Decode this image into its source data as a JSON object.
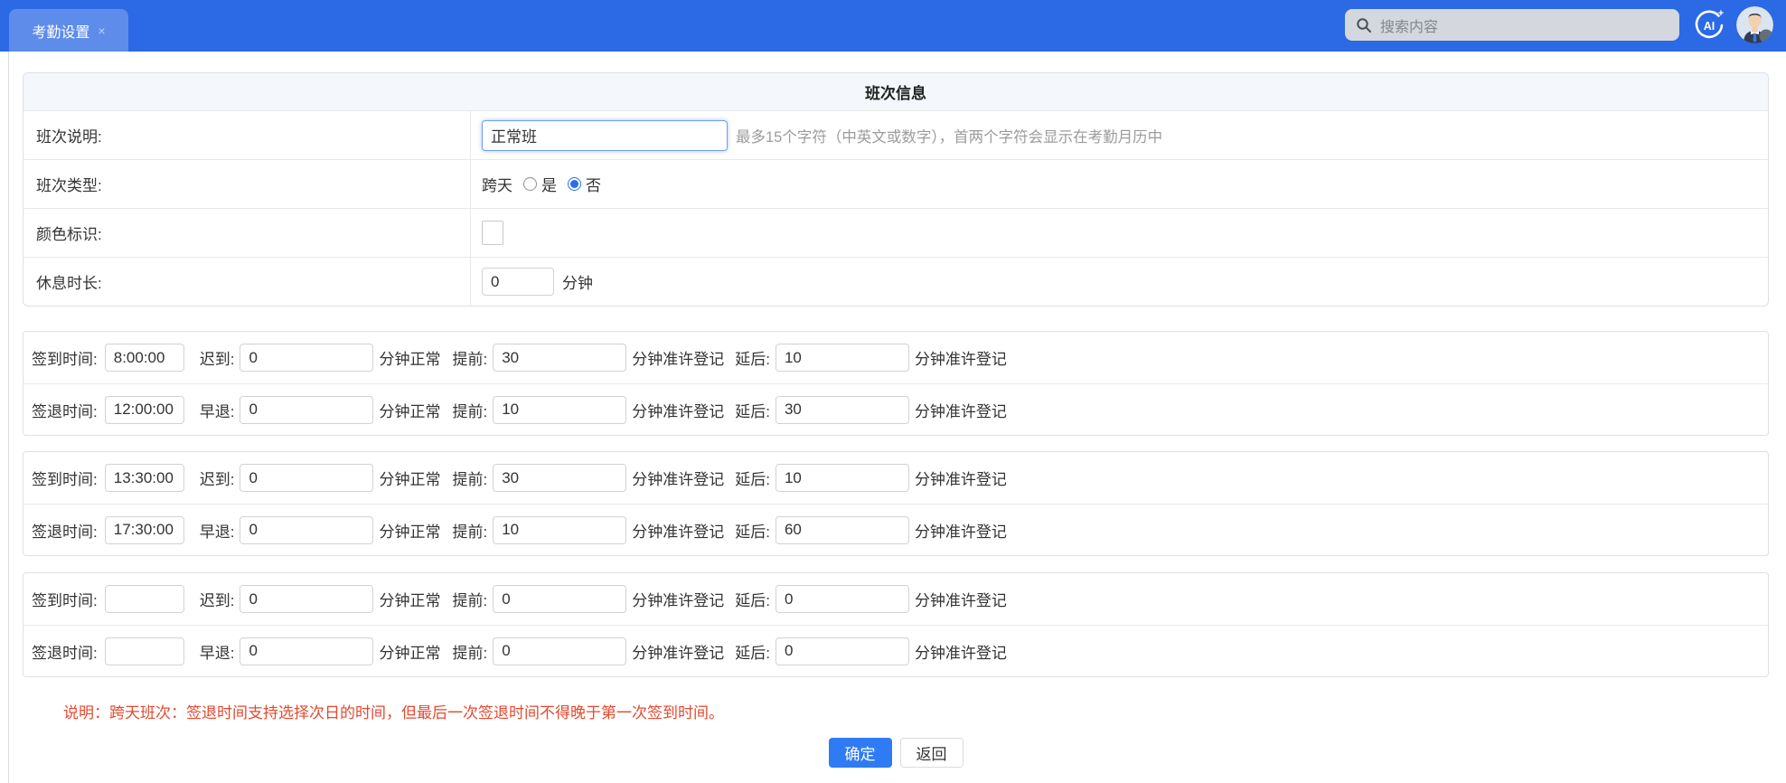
{
  "topbar": {
    "tab_label": "考勤设置",
    "tab_close": "×",
    "search_placeholder": "搜索内容",
    "ai_label": "AI"
  },
  "colors": {
    "topbar_blue": "#2b69e5",
    "primary_button_blue": "#2f7bf4",
    "focused_input_border": "#6b9ff2",
    "note_red": "#e5492f",
    "header_bg": "#f4f8fc"
  },
  "info": {
    "header": "班次信息",
    "desc": {
      "label": "班次说明:",
      "value": "正常班",
      "hint": "最多15个字符（中英文或数字），首两个字符会显示在考勤月历中"
    },
    "type": {
      "label": "班次类型:",
      "field": "跨天",
      "option_yes": "是",
      "option_no": "否",
      "selected": "否"
    },
    "color": {
      "label": "颜色标识:"
    },
    "rest": {
      "label": "休息时长:",
      "value": "0",
      "unit": "分钟"
    }
  },
  "groups": [
    {
      "rows": [
        {
          "time_label": "签到时间:",
          "time_value": "8:00:00",
          "dev_label": "迟到:",
          "dev_value": "0",
          "dev_suffix": "分钟正常",
          "pre_label": "提前:",
          "pre_value": "30",
          "pre_suffix": "分钟准许登记",
          "post_label": "延后:",
          "post_value": "10",
          "post_suffix": "分钟准许登记"
        },
        {
          "time_label": "签退时间:",
          "time_value": "12:00:00",
          "dev_label": "早退:",
          "dev_value": "0",
          "dev_suffix": "分钟正常",
          "pre_label": "提前:",
          "pre_value": "10",
          "pre_suffix": "分钟准许登记",
          "post_label": "延后:",
          "post_value": "30",
          "post_suffix": "分钟准许登记"
        }
      ]
    },
    {
      "rows": [
        {
          "time_label": "签到时间:",
          "time_value": "13:30:00",
          "dev_label": "迟到:",
          "dev_value": "0",
          "dev_suffix": "分钟正常",
          "pre_label": "提前:",
          "pre_value": "30",
          "pre_suffix": "分钟准许登记",
          "post_label": "延后:",
          "post_value": "10",
          "post_suffix": "分钟准许登记"
        },
        {
          "time_label": "签退时间:",
          "time_value": "17:30:00",
          "dev_label": "早退:",
          "dev_value": "0",
          "dev_suffix": "分钟正常",
          "pre_label": "提前:",
          "pre_value": "10",
          "pre_suffix": "分钟准许登记",
          "post_label": "延后:",
          "post_value": "60",
          "post_suffix": "分钟准许登记"
        }
      ]
    },
    {
      "rows": [
        {
          "time_label": "签到时间:",
          "time_value": "",
          "dev_label": "迟到:",
          "dev_value": "0",
          "dev_suffix": "分钟正常",
          "pre_label": "提前:",
          "pre_value": "0",
          "pre_suffix": "分钟准许登记",
          "post_label": "延后:",
          "post_value": "0",
          "post_suffix": "分钟准许登记"
        },
        {
          "time_label": "签退时间:",
          "time_value": "",
          "dev_label": "早退:",
          "dev_value": "0",
          "dev_suffix": "分钟正常",
          "pre_label": "提前:",
          "pre_value": "0",
          "pre_suffix": "分钟准许登记",
          "post_label": "延后:",
          "post_value": "0",
          "post_suffix": "分钟准许登记"
        }
      ]
    }
  ],
  "note": "说明：跨天班次：签退时间支持选择次日的时间，但最后一次签退时间不得晚于第一次签到时间。",
  "actions": {
    "confirm": "确定",
    "back": "返回"
  }
}
